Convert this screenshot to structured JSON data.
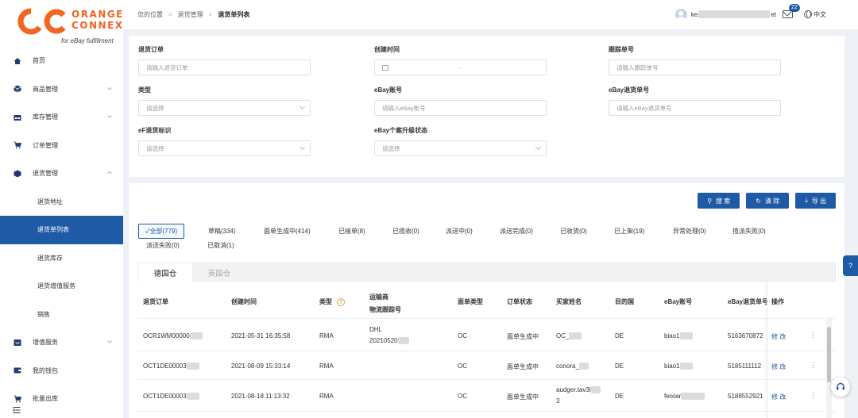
{
  "logo": {
    "line1": "ORANGE",
    "line2": "CONNEX",
    "tagline": "for eBay fulfillment",
    "color": "#f26522"
  },
  "sidebar": {
    "items": [
      {
        "label": "首页",
        "icon": "home-icon"
      },
      {
        "label": "商品管理",
        "icon": "cube-icon",
        "chevron": true
      },
      {
        "label": "库存管理",
        "icon": "warehouse-icon",
        "chevron": true
      },
      {
        "label": "订单管理",
        "icon": "cart-icon"
      },
      {
        "label": "退货管理",
        "icon": "box-icon",
        "chevron": true,
        "expanded": true
      }
    ],
    "sub_items": [
      "退货地址",
      "退货单列表",
      "退货库存",
      "退货增值服务",
      "销售"
    ],
    "items_after": [
      {
        "label": "增值服务",
        "icon": "value-added-icon",
        "chevron": true
      },
      {
        "label": "我的钱包",
        "icon": "wallet-icon"
      },
      {
        "label": "批量出库",
        "icon": "cart-icon"
      }
    ]
  },
  "header": {
    "breadcrumb": [
      "您的位置",
      "退货管理",
      "退货单列表"
    ],
    "user_prefix": "ke",
    "user_suffix": "et",
    "mail_count": "22",
    "lang": "中文"
  },
  "filter": {
    "return_order": {
      "label": "退货订单",
      "placeholder": "请输入退货订单"
    },
    "created_time": {
      "label": "创建时间",
      "range_sep": "-"
    },
    "tracking_no": {
      "label": "跟踪单号",
      "placeholder": "请输入跟踪单号"
    },
    "type": {
      "label": "类型",
      "placeholder": "请选择"
    },
    "ebay_account": {
      "label": "eBay账号",
      "placeholder": "请输入eBay账号"
    },
    "ebay_return_no": {
      "label": "eBay退货单号",
      "placeholder": "请输入eBay退货单号"
    },
    "ef_flag": {
      "label": "eF退货标识",
      "placeholder": "请选择"
    },
    "ebay_case": {
      "label": "eBay个案升级状态",
      "placeholder": "请选择"
    }
  },
  "actions": {
    "search": "搜 索",
    "clear": "清 除",
    "export": "导 出"
  },
  "status_tabs": [
    "全部(779)",
    "草稿(334)",
    "面单生成中(414)",
    "已接单(8)",
    "已揽收(0)",
    "派送中(0)",
    "派送完成(0)",
    "已收货(0)",
    "已上架(19)",
    "异常处理(0)",
    "揽派失败(0)",
    "派送失败(0)",
    "已取消(1)"
  ],
  "warehouse_tabs": [
    "德国仓",
    "英国仓"
  ],
  "table": {
    "headers": {
      "return_order": "退货订单",
      "created": "创建时间",
      "type": "类型",
      "carrier_line1": "运输商",
      "carrier_line2": "物流跟踪号",
      "label_type": "面单类型",
      "status": "订单状态",
      "buyer": "买家姓名",
      "dest": "目的国",
      "ebay_account": "eBay账号",
      "ebay_return_no": "eBay退货单号",
      "op": "操作"
    },
    "rows": [
      {
        "order": "OCR1WM00000",
        "created": "2021-05-31 16:35:58",
        "type": "RMA",
        "carrier": "DHL",
        "tracking": "20210520",
        "label_type": "OC",
        "status": "面单生成中",
        "buyer": "OC_",
        "dest": "DE",
        "account": "biao1",
        "ebay_no": "5163670872",
        "op": "修 改"
      },
      {
        "order": "OCT1DE00003",
        "created": "2021-08-09 15:33:14",
        "type": "RMA",
        "carrier": "",
        "tracking": "",
        "label_type": "OC",
        "status": "面单生成中",
        "buyer": "conora_",
        "dest": "DE",
        "account": "biao1",
        "ebay_no": "5185111112",
        "op": "修 改"
      },
      {
        "order": "OCT1DE00003",
        "created": "2021-08-18 11:13:32",
        "type": "RMA",
        "carrier": "",
        "tracking": "",
        "label_type": "OC",
        "status": "面单生成中",
        "buyer": "audger.tav3l",
        "buyer2": "3",
        "dest": "DE",
        "account": "feixiar",
        "ebay_no": "5188552921",
        "op": "修 改"
      }
    ]
  },
  "colors": {
    "primary": "#1f5aa6",
    "accent": "#f26522",
    "bg": "#eef1f6"
  }
}
